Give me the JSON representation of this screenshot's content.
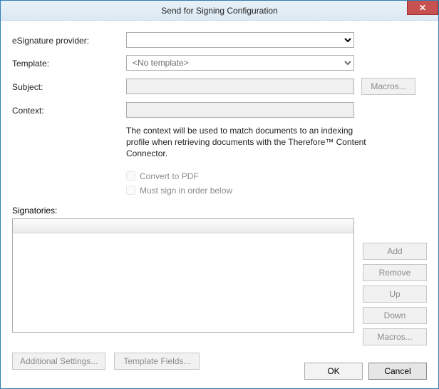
{
  "window": {
    "title": "Send for Signing Configuration"
  },
  "labels": {
    "provider": "eSignature provider:",
    "template": "Template:",
    "subject": "Subject:",
    "context": "Context:",
    "signatories": "Signatories:"
  },
  "fields": {
    "provider_value": "",
    "template_value": "<No template>",
    "subject_value": "",
    "context_value": ""
  },
  "help": {
    "context": "The context will be used to match documents to an indexing profile when retrieving documents with the Therefore™ Content Connector."
  },
  "checkboxes": {
    "convert_pdf": "Convert to PDF",
    "must_sign_order": "Must sign in order below"
  },
  "buttons": {
    "macros_subject": "Macros...",
    "add": "Add",
    "remove": "Remove",
    "up": "Up",
    "down": "Down",
    "macros_sig": "Macros...",
    "additional_settings": "Additional Settings...",
    "template_fields": "Template Fields...",
    "ok": "OK",
    "cancel": "Cancel"
  }
}
